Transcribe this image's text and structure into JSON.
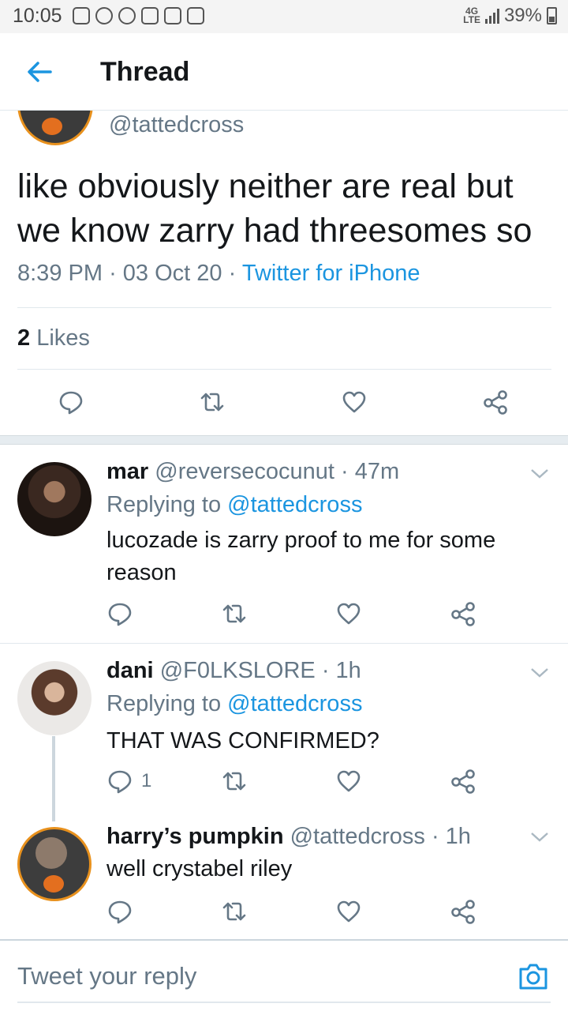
{
  "status_bar": {
    "time": "10:05",
    "network": "4G",
    "network_sub": "LTE",
    "battery": "39%"
  },
  "header": {
    "title": "Thread"
  },
  "focused_tweet": {
    "handle": "@tattedcross",
    "text": "like obviously neither are real but we know zarry had threesomes so",
    "time": "8:39 PM",
    "date": "03 Oct 20",
    "sep": "·",
    "source": "Twitter for iPhone",
    "likes_count": "2",
    "likes_label": "Likes"
  },
  "replies": [
    {
      "name": "mar",
      "handle": "@reversecocunut",
      "age": "· 47m",
      "replying_prefix": "Replying to",
      "replying_to": "@tattedcross",
      "text": "lucozade is zarry proof to me for some reason",
      "reply_count": ""
    },
    {
      "name": "dani",
      "handle": "@F0LKSLORE",
      "age": "· 1h",
      "replying_prefix": "Replying to",
      "replying_to": "@tattedcross",
      "text": "THAT WAS CONFIRMED?",
      "reply_count": "1"
    },
    {
      "name": "harry’s pumpkin",
      "handle": "@tattedcross",
      "age": "· 1h",
      "text": "well crystabel riley",
      "reply_count": ""
    }
  ],
  "composer": {
    "placeholder": "Tweet your reply"
  },
  "colors": {
    "accent": "#1b95e0",
    "text_primary": "#14171a",
    "text_secondary": "#657786",
    "avatar_ring": "#e8911d"
  },
  "icons": [
    "back-arrow-icon",
    "reply-icon",
    "retweet-icon",
    "like-icon",
    "share-icon",
    "chevron-down-icon",
    "camera-icon"
  ]
}
